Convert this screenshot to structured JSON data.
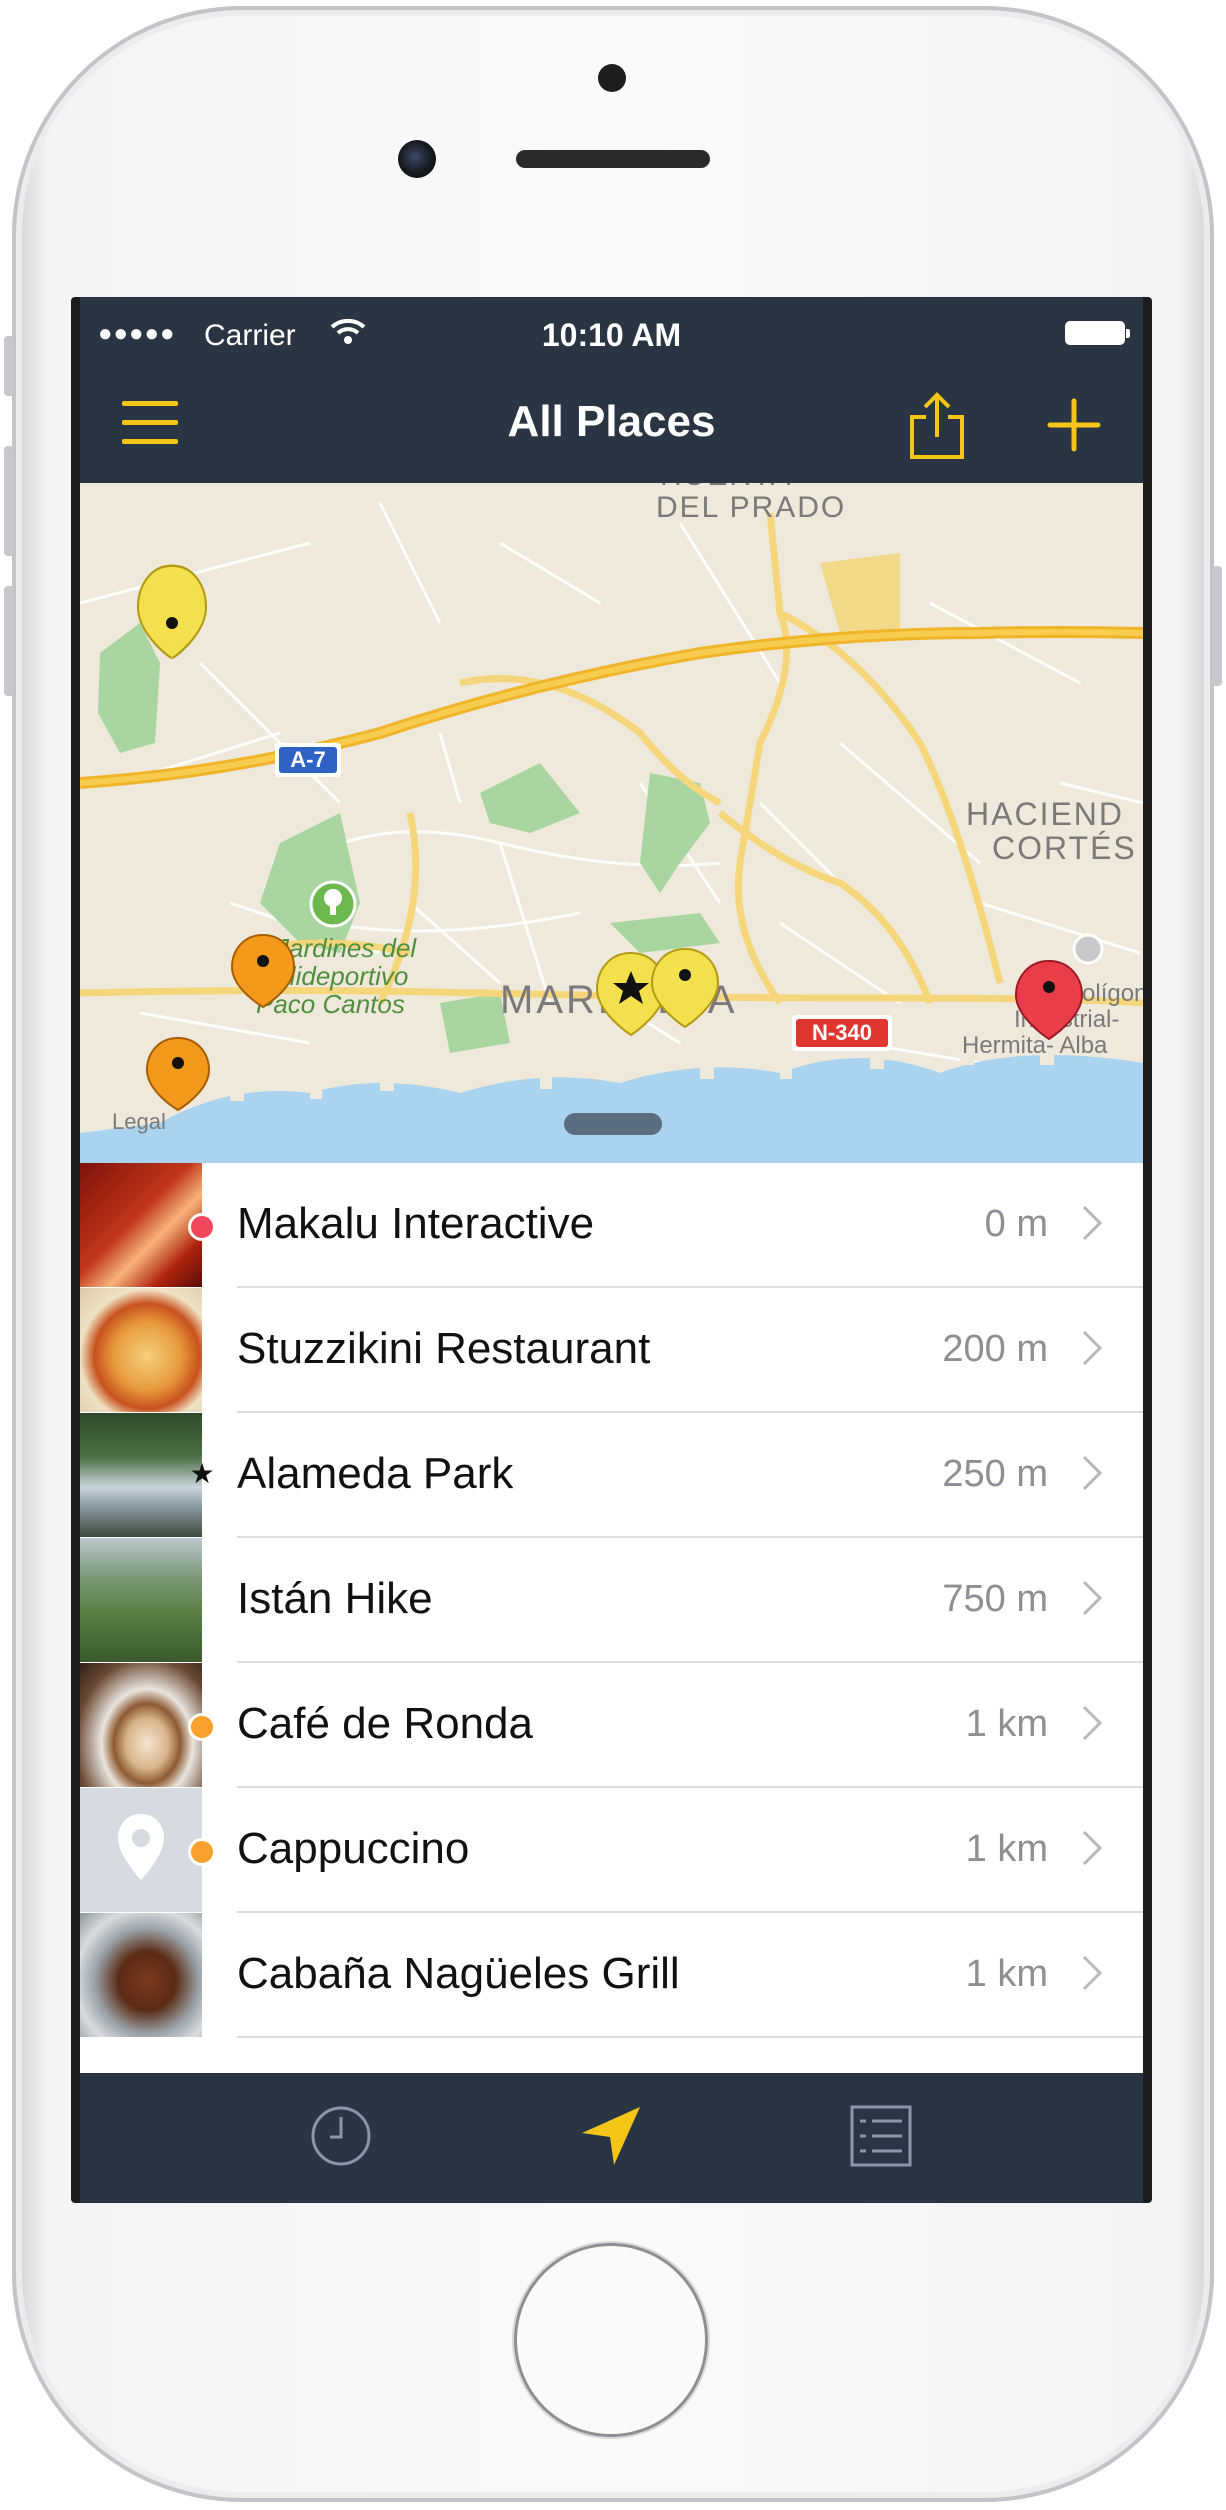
{
  "status_bar": {
    "signal": "●●●●●",
    "carrier": "Carrier",
    "time": "10:10 AM"
  },
  "nav": {
    "title": "All Places"
  },
  "colors": {
    "accent": "#f5c518",
    "navbar": "#2a3544",
    "dot_red": "#f0475a",
    "dot_orange": "#f7a12c"
  },
  "map": {
    "labels": {
      "del_prado_1": "HUERTA",
      "del_prado_2": "DEL PRADO",
      "hacienda_1": "HACIEND",
      "hacienda_2": "CORTÉS",
      "jardines_1": "Jardines del",
      "jardines_2": "Polideportivo",
      "jardines_3": "Paco Cantos",
      "marbella": "MARBELLA",
      "poligono_1": "Polígono",
      "poligono_2": "Industrial-",
      "poligono_3": "Hermita- Alba",
      "legal": "Legal",
      "road_a7": "A-7",
      "road_n340": "N-340"
    }
  },
  "places": [
    {
      "name": "Makalu Interactive",
      "distance": "0 m",
      "marker": "red-dot"
    },
    {
      "name": "Stuzzikini Restaurant",
      "distance": "200 m",
      "marker": "none"
    },
    {
      "name": "Alameda Park",
      "distance": "250 m",
      "marker": "star"
    },
    {
      "name": "Istán Hike",
      "distance": "750 m",
      "marker": "none"
    },
    {
      "name": "Café de Ronda",
      "distance": "1 km",
      "marker": "orange-dot"
    },
    {
      "name": "Cappuccino",
      "distance": "1 km",
      "marker": "orange-dot"
    },
    {
      "name": "Cabaña Nagüeles Grill",
      "distance": "1 km",
      "marker": "none"
    }
  ],
  "tabs": {
    "recent": "clock-icon",
    "nearby": "location-arrow-icon",
    "list": "list-icon",
    "active": "nearby"
  }
}
